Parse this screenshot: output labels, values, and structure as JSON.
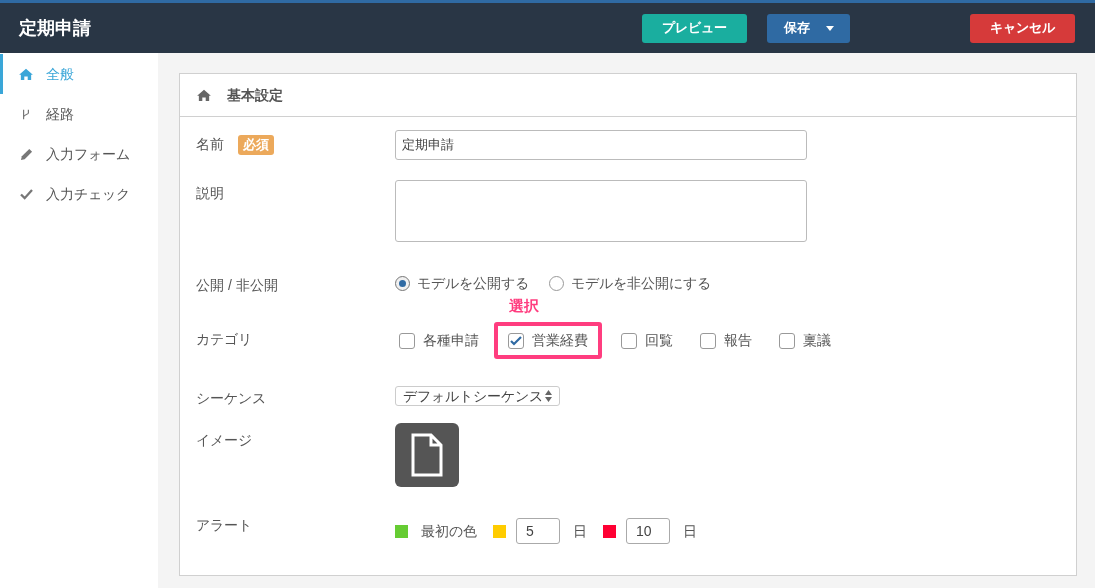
{
  "header": {
    "title": "定期申請",
    "buttons": [
      {
        "kind": "preview",
        "label": "プレビュー"
      },
      {
        "kind": "save",
        "label": "保存"
      },
      {
        "kind": "cancel",
        "label": "キャンセル"
      }
    ]
  },
  "sidebar": {
    "items": [
      {
        "kind": "home",
        "label": "全般",
        "selected": true
      },
      {
        "kind": "fork",
        "label": "経路",
        "selected": false
      },
      {
        "kind": "pencil",
        "label": "入力フォーム",
        "selected": false
      },
      {
        "kind": "check",
        "label": "入力チェック",
        "selected": false
      }
    ]
  },
  "panel": {
    "title": "基本設定",
    "name": {
      "label": "名前",
      "badge": "必須",
      "value": "定期申請"
    },
    "description": {
      "label": "説明"
    },
    "visibility": {
      "label": "公開 / 非公開",
      "options": [
        {
          "label": "モデルを公開する",
          "selected": true
        },
        {
          "label": "モデルを非公開にする",
          "selected": false
        }
      ]
    },
    "category": {
      "label": "カテゴリ",
      "annotation": "選択",
      "options": [
        {
          "label": "各種申請",
          "checked": false,
          "highlighted": false
        },
        {
          "label": "営業経費",
          "checked": true,
          "highlighted": true
        },
        {
          "label": "回覧",
          "checked": false,
          "highlighted": false
        },
        {
          "label": "報告",
          "checked": false,
          "highlighted": false
        },
        {
          "label": "稟議",
          "checked": false,
          "highlighted": false
        }
      ]
    },
    "sequence": {
      "label": "シーケンス",
      "value": "デフォルトシーケンス"
    },
    "image": {
      "label": "イメージ"
    },
    "alert": {
      "label": "アラート",
      "items": [
        {
          "kind": "text",
          "color": "#66cc33",
          "text": "最初の色"
        },
        {
          "kind": "days",
          "color": "#ffcc00",
          "value": "5",
          "unit": "日"
        },
        {
          "kind": "days",
          "color": "#ff0033",
          "value": "10",
          "unit": "日"
        }
      ]
    }
  }
}
